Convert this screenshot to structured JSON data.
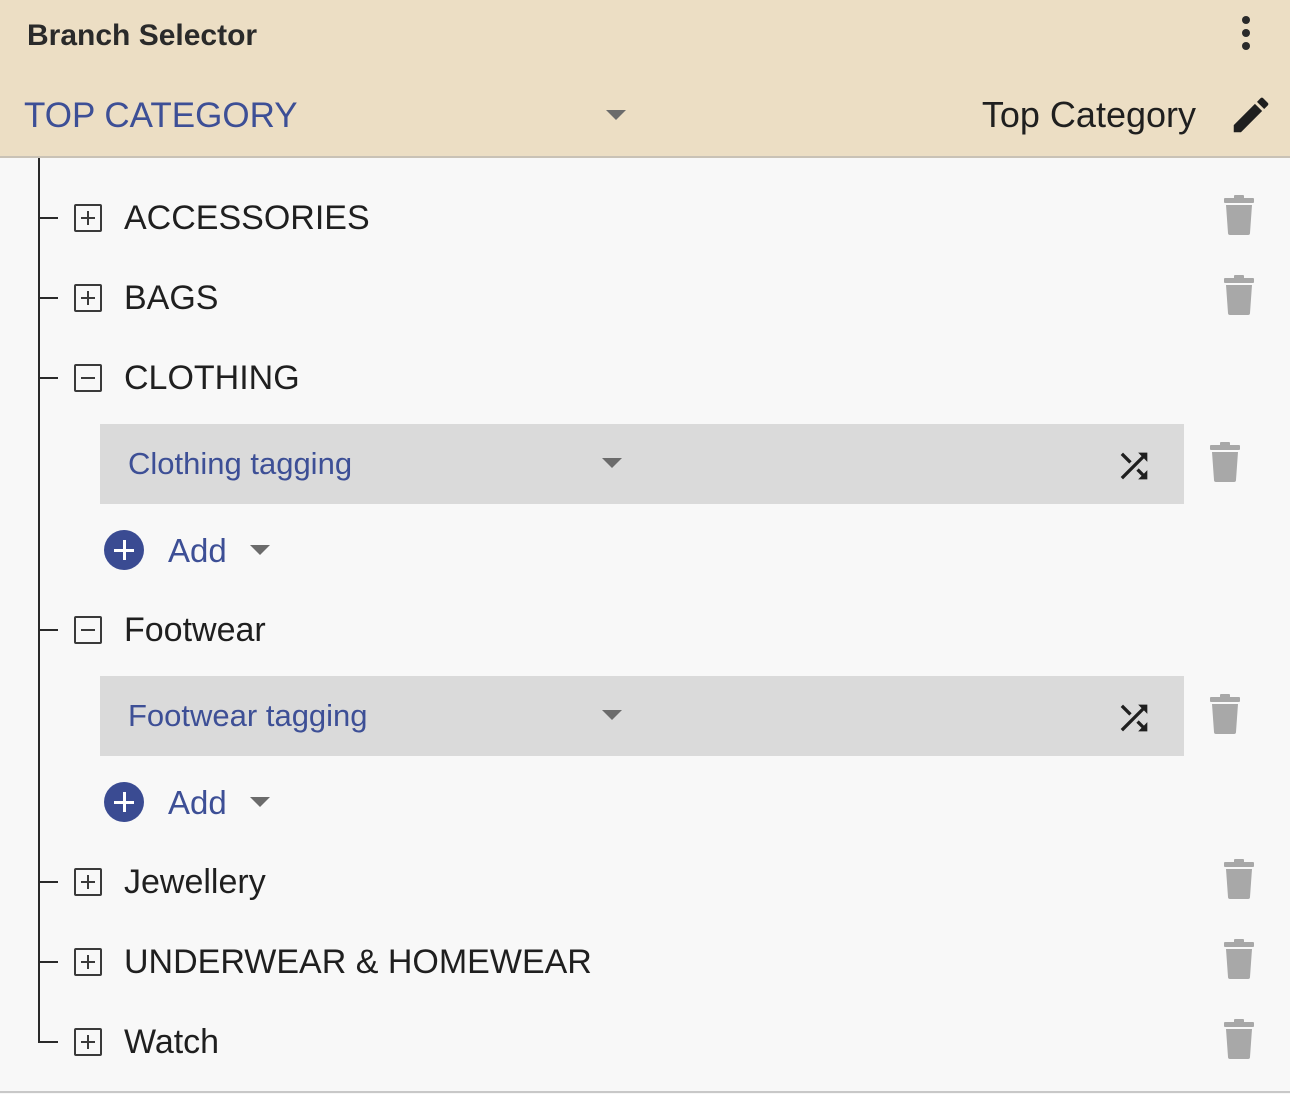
{
  "header": {
    "title": "Branch Selector",
    "category_select_label": "TOP CATEGORY",
    "category_name": "Top Category"
  },
  "tree": {
    "nodes": [
      {
        "label": "ACCESSORIES",
        "expanded": false
      },
      {
        "label": "BAGS",
        "expanded": false
      },
      {
        "label": "CLOTHING",
        "expanded": true,
        "tagging": "Clothing tagging",
        "add_label": "Add"
      },
      {
        "label": "Footwear",
        "expanded": true,
        "tagging": "Footwear tagging",
        "add_label": "Add"
      },
      {
        "label": "Jewellery",
        "expanded": false
      },
      {
        "label": "UNDERWEAR & HOMEWEAR",
        "expanded": false
      },
      {
        "label": "Watch",
        "expanded": false
      }
    ]
  },
  "colors": {
    "header_bg": "#ecdec4",
    "accent_blue": "#3d4f96",
    "trash_gray": "#a8a8a8",
    "tag_box_bg": "#dadada"
  }
}
